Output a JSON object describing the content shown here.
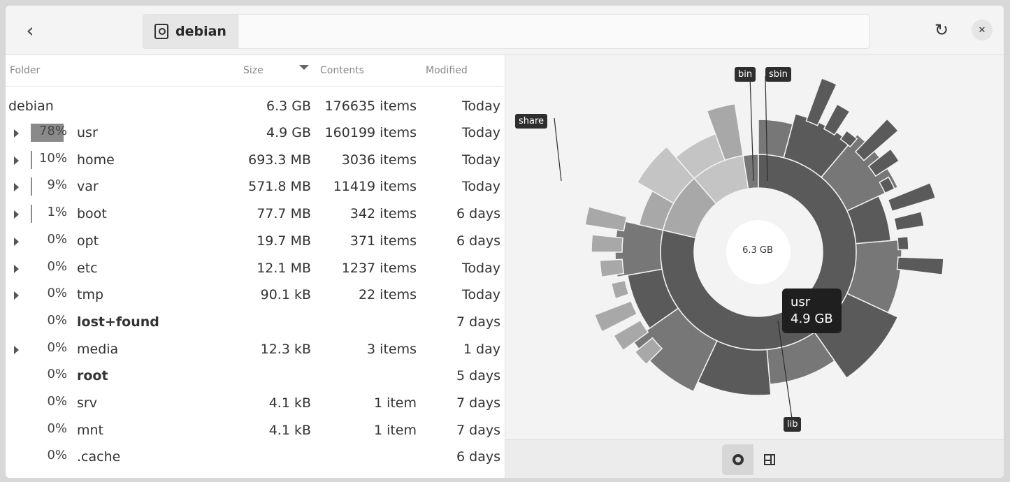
{
  "header": {
    "path": "debian"
  },
  "columns": {
    "folder": "Folder",
    "size": "Size",
    "contents": "Contents",
    "modified": "Modified"
  },
  "root": {
    "name": "debian",
    "size": "6.3 GB",
    "contents": "176635 items",
    "modified": "Today"
  },
  "rows": [
    {
      "pct": "78%",
      "fill": 0.78,
      "name": "usr",
      "size": "4.9 GB",
      "contents": "160199 items",
      "modified": "Today",
      "expandable": true
    },
    {
      "pct": "10%",
      "fill": 0.1,
      "name": "home",
      "size": "693.3 MB",
      "contents": "3036 items",
      "modified": "Today",
      "expandable": true
    },
    {
      "pct": "9%",
      "fill": 0.09,
      "name": "var",
      "size": "571.8 MB",
      "contents": "11419 items",
      "modified": "Today",
      "expandable": true
    },
    {
      "pct": "1%",
      "fill": 0.01,
      "name": "boot",
      "size": "77.7 MB",
      "contents": "342 items",
      "modified": "6 days",
      "expandable": true
    },
    {
      "pct": "0%",
      "fill": 0,
      "name": "opt",
      "size": "19.7 MB",
      "contents": "371 items",
      "modified": "6 days",
      "expandable": true
    },
    {
      "pct": "0%",
      "fill": 0,
      "name": "etc",
      "size": "12.1 MB",
      "contents": "1237 items",
      "modified": "Today",
      "expandable": true
    },
    {
      "pct": "0%",
      "fill": 0,
      "name": "tmp",
      "size": "90.1 kB",
      "contents": "22 items",
      "modified": "Today",
      "expandable": true
    },
    {
      "pct": "0%",
      "fill": 0,
      "name": "lost+found",
      "size": "",
      "contents": "",
      "modified": "7 days",
      "expandable": false,
      "bold": true
    },
    {
      "pct": "0%",
      "fill": 0,
      "name": "media",
      "size": "12.3 kB",
      "contents": "3 items",
      "modified": "1 day",
      "expandable": true
    },
    {
      "pct": "0%",
      "fill": 0,
      "name": "root",
      "size": "",
      "contents": "",
      "modified": "5 days",
      "expandable": false,
      "bold": true
    },
    {
      "pct": "0%",
      "fill": 0,
      "name": "srv",
      "size": "4.1 kB",
      "contents": "1 item",
      "modified": "7 days",
      "expandable": false
    },
    {
      "pct": "0%",
      "fill": 0,
      "name": "mnt",
      "size": "4.1 kB",
      "contents": "1 item",
      "modified": "7 days",
      "expandable": false
    },
    {
      "pct": "0%",
      "fill": 0,
      "name": ".cache",
      "size": "",
      "contents": "",
      "modified": "6 days",
      "expandable": false
    }
  ],
  "chart": {
    "center_label": "6.3 GB",
    "labels": {
      "share": "share",
      "bin": "bin",
      "sbin": "sbin",
      "lib": "lib"
    },
    "tooltip": {
      "name": "usr",
      "size": "4.9 GB"
    }
  },
  "colors": {
    "accent": "#8a8a8a",
    "ring_dark": "#5a5a5a",
    "ring_mid": "#777777",
    "ring_light": "#a8a8a8",
    "ring_pale": "#c4c4c4"
  },
  "icons": {
    "back": "go-previous-icon",
    "disk": "drive-harddisk-icon",
    "reload": "view-refresh-icon",
    "close": "window-close-icon",
    "rings": "rings-chart-icon",
    "treemap": "treemap-chart-icon"
  }
}
